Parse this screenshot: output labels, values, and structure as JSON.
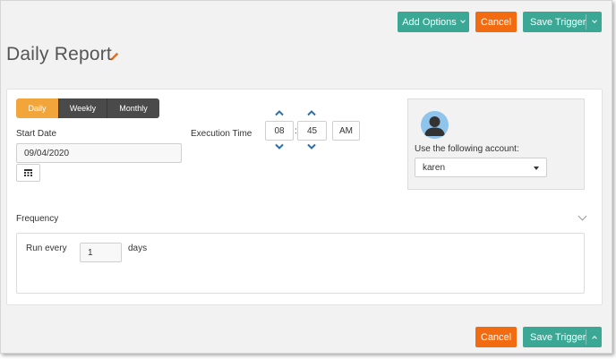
{
  "toolbar_top": {
    "add_options_label": "Add Options",
    "cancel_label": "Cancel",
    "save_trigger_label": "Save Trigger"
  },
  "page": {
    "title": "Daily Report"
  },
  "schedule": {
    "tabs": [
      {
        "label": "Daily",
        "active": true
      },
      {
        "label": "Weekly",
        "active": false
      },
      {
        "label": "Monthly",
        "active": false
      }
    ],
    "start_date_label": "Start Date",
    "start_date_value": "09/04/2020",
    "execution_time_label": "Execution Time",
    "hour": "08",
    "separator": ":",
    "minute": "45",
    "ampm": "AM"
  },
  "account": {
    "label": "Use the following account:",
    "selected": "karen"
  },
  "frequency": {
    "label": "Frequency",
    "run_every_label": "Run every",
    "run_every_value": "1",
    "unit_label": "days"
  },
  "toolbar_bottom": {
    "cancel_label": "Cancel",
    "save_trigger_label": "Save Trigger"
  },
  "colors": {
    "teal": "#3ba795",
    "orange": "#f26b11",
    "active_tab": "#f2a53a",
    "inactive_tab": "#4a4a4a",
    "spinner_blue": "#2a6fa8",
    "avatar_bg": "#8fc4ec"
  },
  "icons": [
    "pencil-icon",
    "calendar-icon",
    "chevron-up-icon",
    "chevron-down-icon",
    "user-avatar-icon",
    "caret-down-icon"
  ]
}
